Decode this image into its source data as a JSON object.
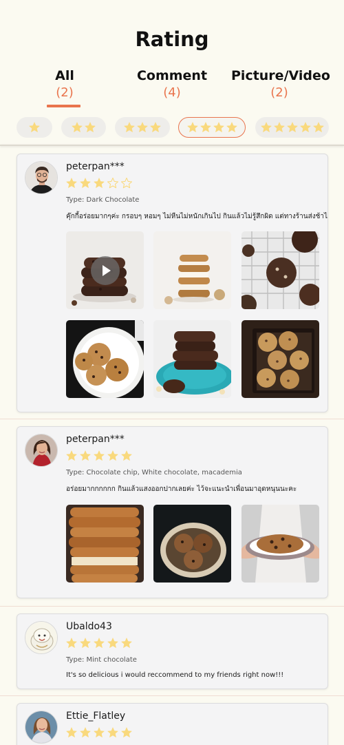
{
  "page": {
    "title": "Rating"
  },
  "tabs": [
    {
      "label": "All",
      "count": "(2)"
    },
    {
      "label": "Comment",
      "count": "(4)"
    },
    {
      "label": "Picture/Video",
      "count": "(2)"
    }
  ],
  "active_tab": "All",
  "star_filters": [
    {
      "stars": 1,
      "selected": false
    },
    {
      "stars": 2,
      "selected": false
    },
    {
      "stars": 3,
      "selected": false
    },
    {
      "stars": 4,
      "selected": true
    },
    {
      "stars": 5,
      "selected": false
    }
  ],
  "reviews": [
    {
      "username": "peterpan***",
      "rating": 3,
      "type": "Type: Dark Chocolate",
      "comment": "คุ๊กกี้อร่อยมากๆค่ะ กรอบๆ หอมๆ ไม่หืนไม่หนักเกินไป กินแล้วไม่รู้สึกผิด แต่ทางร้านส่งช้าไปหน่อย",
      "photos": [
        "video-stack-cookies",
        "ice-cream-sandwich-cookies",
        "cookies-on-cooling-rack",
        "cookies-on-white-plate",
        "stacked-cookies-teal-plate",
        "cookies-in-box"
      ]
    },
    {
      "username": "peterpan***",
      "rating": 5,
      "type": "Type: Chocolate chip, White chocolate, macademia",
      "comment": "อร่อยมากกกกกก กินแล้วแสงออกปากเลยค่ะ ไว้จะแนะนำเพื่อนมาอุดหนุนนะคะ",
      "photos": [
        "tall-cookie-stack",
        "cookies-in-basket",
        "hands-holding-cookie-plate"
      ]
    },
    {
      "username": "Ubaldo43",
      "rating": 5,
      "type": "Type: Mint chocolate",
      "comment": "It's so delicious i would reccommend to my friends right now!!!",
      "photos": []
    },
    {
      "username": "Ettie_Flatley",
      "rating": 5,
      "type": "",
      "comment": "",
      "photos": []
    }
  ],
  "colors": {
    "accent": "#E9744D",
    "star": "#F9D97D",
    "background": "#FBFAF1",
    "card": "#F4F4F5"
  }
}
